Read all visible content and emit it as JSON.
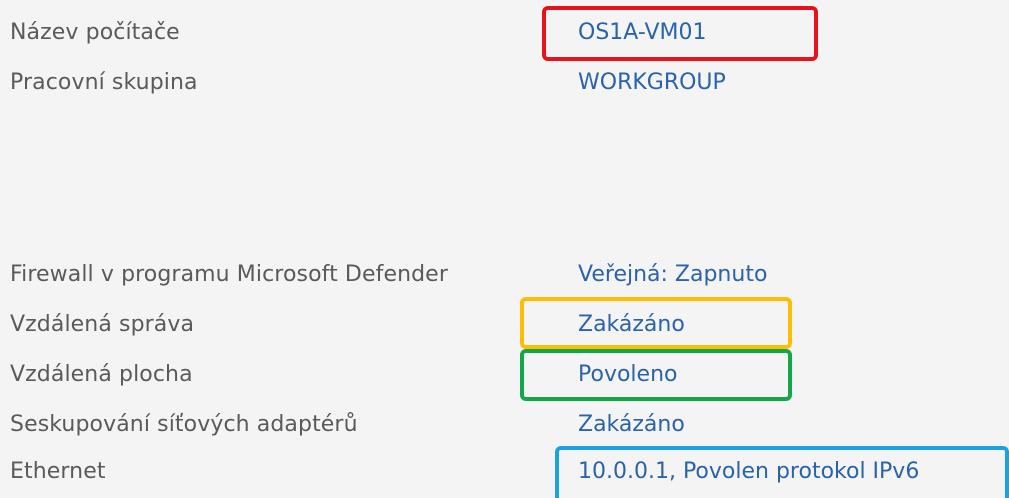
{
  "properties": [
    {
      "label": "Název počítače",
      "value": "OS1A-VM01"
    },
    {
      "label": "Pracovní skupina",
      "value": "WORKGROUP"
    },
    {
      "label": "Firewall v programu Microsoft Defender",
      "value": "Veřejná: Zapnuto"
    },
    {
      "label": "Vzdálená správa",
      "value": "Zakázáno"
    },
    {
      "label": "Vzdálená plocha",
      "value": "Povoleno"
    },
    {
      "label": "Seskupování síťových adaptérů",
      "value": "Zakázáno"
    },
    {
      "label": "Ethernet",
      "value": "10.0.0.1, Povolen protokol IPv6"
    }
  ],
  "colors": {
    "background": "#f4f4f4",
    "label_text": "#5a5a5a",
    "link_text": "#2b63a8",
    "highlight_red": "#e8121a",
    "highlight_orange": "#ffbf00",
    "highlight_green": "#13a64a",
    "highlight_blue": "#1aa3e0"
  }
}
